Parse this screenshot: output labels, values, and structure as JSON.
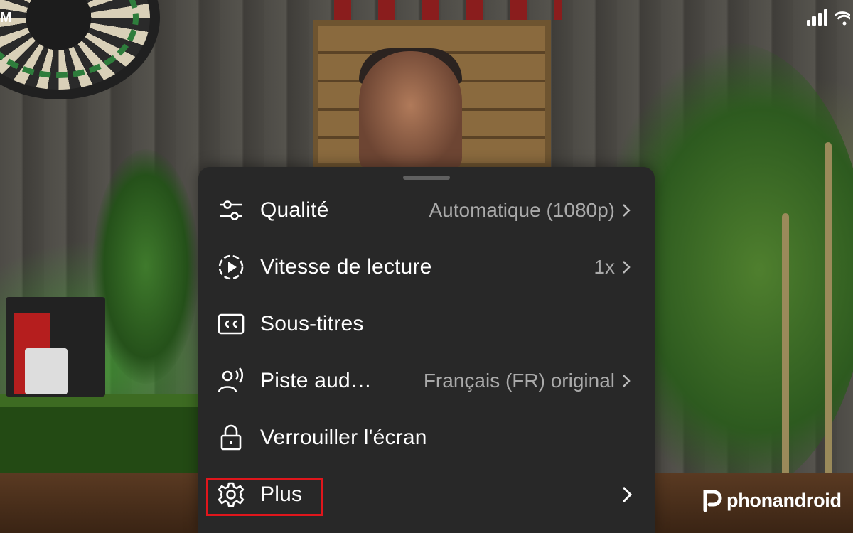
{
  "status": {
    "app_icon_letter": "M"
  },
  "menu": {
    "items": [
      {
        "icon": "sliders-icon",
        "label": "Qualité",
        "value": "Automatique (1080p)",
        "has_chevron": true
      },
      {
        "icon": "playback-speed-icon",
        "label": "Vitesse de lecture",
        "value": "1x",
        "has_chevron": true
      },
      {
        "icon": "closed-captions-icon",
        "label": "Sous-titres",
        "value": "",
        "has_chevron": false
      },
      {
        "icon": "audio-track-icon",
        "label": "Piste aud…",
        "value": "Français (FR) original",
        "has_chevron": true
      },
      {
        "icon": "lock-icon",
        "label": "Verrouiller l'écran",
        "value": "",
        "has_chevron": false
      },
      {
        "icon": "gear-icon",
        "label": "Plus",
        "value": "",
        "has_chevron": true
      }
    ]
  },
  "highlight_color": "#e0161c",
  "sheet_color": "#282828",
  "watermark": {
    "name": "phonandroid"
  }
}
